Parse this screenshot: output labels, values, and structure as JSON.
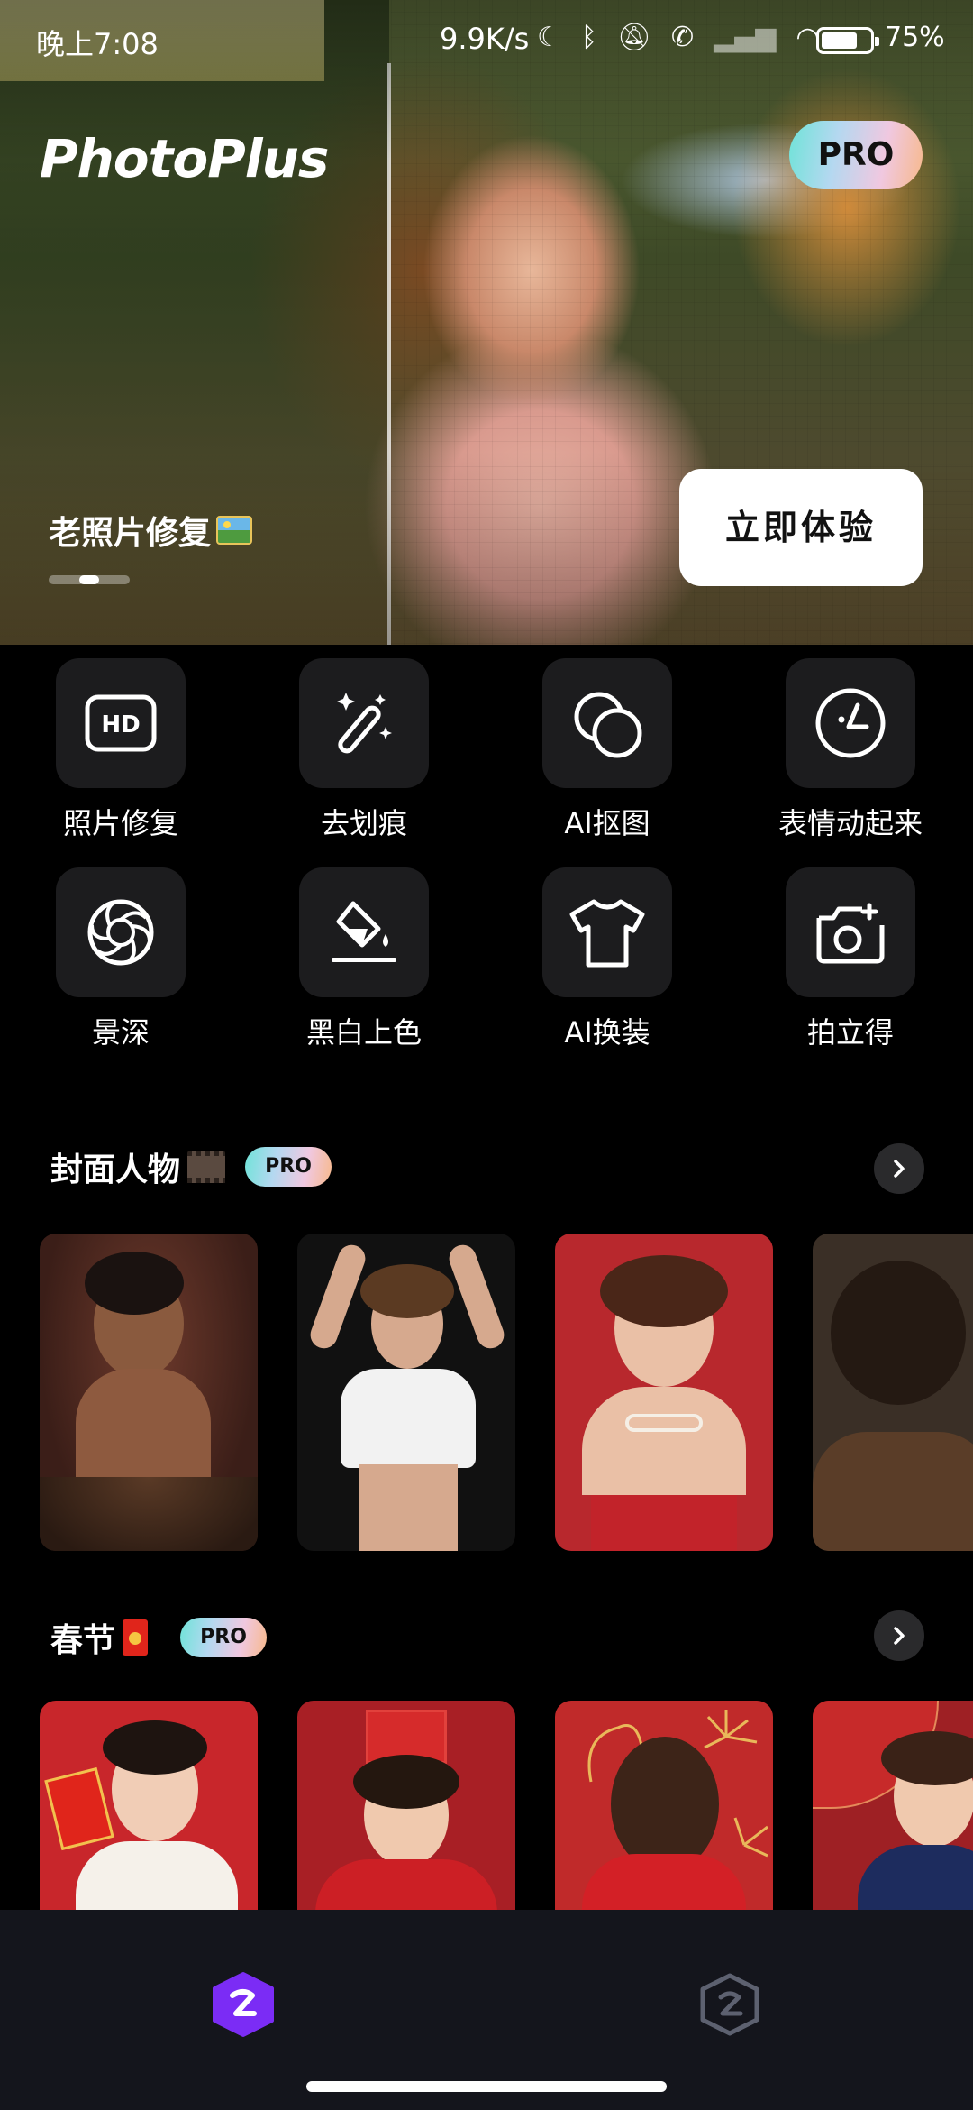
{
  "status_bar": {
    "time": "晚上7:08",
    "network_rate": "9.9K/s",
    "battery": "75%",
    "battery_level": 0.75
  },
  "hero": {
    "logo": "PhotoPlus",
    "pro_badge": "PRO",
    "caption": "老照片修复",
    "cta_label": "立即体验",
    "carousel_index": 2
  },
  "tools": [
    {
      "label": "照片修复",
      "icon": "hd-icon"
    },
    {
      "label": "去划痕",
      "icon": "magic-wand-icon"
    },
    {
      "label": "AI抠图",
      "icon": "overlap-circles-icon"
    },
    {
      "label": "表情动起来",
      "icon": "face-clock-icon"
    },
    {
      "label": "景深",
      "icon": "aperture-icon"
    },
    {
      "label": "黑白上色",
      "icon": "paint-bucket-icon"
    },
    {
      "label": "AI换装",
      "icon": "tshirt-icon"
    },
    {
      "label": "拍立得",
      "icon": "camera-icon"
    }
  ],
  "sections": [
    {
      "title": "封面人物",
      "badge": "PRO"
    },
    {
      "title": "春节",
      "badge": "PRO"
    }
  ],
  "colors": {
    "background": "#000000",
    "tile": "#1c1c1e",
    "nav_bar": "#14151c",
    "accent_purple": "#7b2cf5",
    "cta_background": "#ffffff"
  }
}
